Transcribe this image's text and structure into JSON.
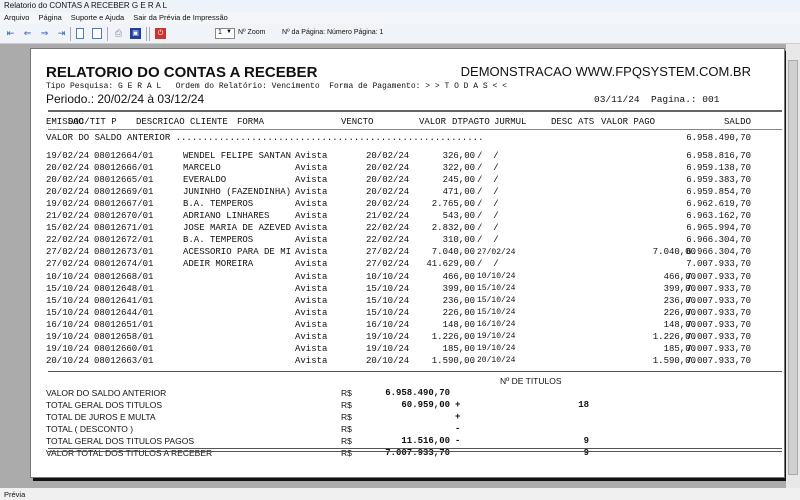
{
  "window": {
    "title": "Relatorio do CONTAS A RECEBER G E R A L"
  },
  "menu": [
    "Arquivo",
    "Página",
    "Suporte e Ajuda",
    "Sair da Prévia de Impressão"
  ],
  "toolbar": {
    "zoom_value": "1",
    "zoom_label": "Nº Zoom",
    "page_label": "Nº da Página: Número Página: 1"
  },
  "report": {
    "title": "RELATORIO DO CONTAS A RECEBER",
    "company": "DEMONSTRACAO WWW.FPQSYSTEM.COM.BR",
    "filters": "Tipo Pesquisa: G E R A L   Ordem do Relatório: Vencimento  Forma de Pagamento: > > T O D A S < <",
    "period": "Periodo.: 20/02/24 à 03/12/24",
    "date": "03/11/24",
    "page": "Pagina.: 001",
    "columns": {
      "emissao": "EMISSAO",
      "doc": "DOC/TIT P",
      "desc": "DESCRICAO CLIENTE",
      "forma": "FORMA",
      "vencto": "VENCTO",
      "valor": "VALOR",
      "dtpagto": "DTPAGTO",
      "jurmul": "JURMUL",
      "desc_ats": "DESC ATS",
      "valor_pago": "VALOR PAGO",
      "saldo": "SALDO"
    },
    "saldo_anterior_label": "VALOR DO SALDO ANTERIOR .........................................................",
    "saldo_anterior": "6.958.490,70",
    "rows": [
      [
        "19/02/24",
        "08012664/01",
        "WENDEL FELIPE SANTAN",
        "Avista",
        "20/02/24",
        "326,00",
        "/  /",
        "",
        "6.958.816,70"
      ],
      [
        "20/02/24",
        "08012666/01",
        "MARCELO",
        "Avista",
        "20/02/24",
        "322,00",
        "/  /",
        "",
        "6.959.138,70"
      ],
      [
        "20/02/24",
        "08012665/01",
        "EVERALDO",
        "Avista",
        "20/02/24",
        "245,00",
        "/  /",
        "",
        "6.959.383,70"
      ],
      [
        "20/02/24",
        "08012669/01",
        "JUNINHO (FAZENDINHA)",
        "Avista",
        "20/02/24",
        "471,00",
        "/  /",
        "",
        "6.959.854,70"
      ],
      [
        "19/02/24",
        "08012667/01",
        "B.A. TEMPEROS",
        "Avista",
        "20/02/24",
        "2.765,00",
        "/  /",
        "",
        "6.962.619,70"
      ],
      [
        "21/02/24",
        "08012670/01",
        "ADRIANO LINHARES",
        "Avista",
        "21/02/24",
        "543,00",
        "/  /",
        "",
        "6.963.162,70"
      ],
      [
        "15/02/24",
        "08012671/01",
        "JOSE MARIA DE AZEVED",
        "Avista",
        "22/02/24",
        "2.832,00",
        "/  /",
        "",
        "6.965.994,70"
      ],
      [
        "22/02/24",
        "08012672/01",
        "B.A. TEMPEROS",
        "Avista",
        "22/02/24",
        "310,00",
        "/  /",
        "",
        "6.966.304,70"
      ],
      [
        "27/02/24",
        "08012673/01",
        "ACESSORIO PARA DE MI",
        "Avista",
        "27/02/24",
        "7.040,00",
        "27/02/24",
        "7.040,00",
        "6.966.304,70"
      ],
      [
        "27/02/24",
        "08012674/01",
        "ADEIR MOREIRA",
        "Avista",
        "27/02/24",
        "41.629,00",
        "/  /",
        "",
        "7.007.933,70"
      ],
      [
        "10/10/24",
        "08012668/01",
        "",
        "Avista",
        "10/10/24",
        "466,00",
        "10/10/24",
        "466,00",
        "7.007.933,70"
      ],
      [
        "15/10/24",
        "08012648/01",
        "",
        "Avista",
        "15/10/24",
        "399,00",
        "15/10/24",
        "399,00",
        "7.007.933,70"
      ],
      [
        "15/10/24",
        "08012641/01",
        "",
        "Avista",
        "15/10/24",
        "236,00",
        "15/10/24",
        "236,00",
        "7.007.933,70"
      ],
      [
        "15/10/24",
        "08012644/01",
        "",
        "Avista",
        "15/10/24",
        "226,00",
        "15/10/24",
        "226,00",
        "7.007.933,70"
      ],
      [
        "16/10/24",
        "08012651/01",
        "",
        "Avista",
        "16/10/24",
        "148,00",
        "16/10/24",
        "148,00",
        "7.007.933,70"
      ],
      [
        "19/10/24",
        "08012658/01",
        "",
        "Avista",
        "19/10/24",
        "1.226,00",
        "19/10/24",
        "1.226,00",
        "7.007.933,70"
      ],
      [
        "19/10/24",
        "08012660/01",
        "",
        "Avista",
        "19/10/24",
        "185,00",
        "19/10/24",
        "185,00",
        "7.007.933,70"
      ],
      [
        "20/10/24",
        "08012663/01",
        "",
        "Avista",
        "20/10/24",
        "1.590,00",
        "20/10/24",
        "1.590,00",
        "7.007.933,70"
      ]
    ],
    "summary": {
      "count_header": "Nº DE TITULOS",
      "lines": [
        {
          "label": "VALOR DO SALDO ANTERIOR",
          "cur": "R$",
          "value": "6.958.490,70",
          "sign": "",
          "count": ""
        },
        {
          "label": "TOTAL GERAL DOS TITULOS",
          "cur": "R$",
          "value": "60.959,00",
          "sign": "+",
          "count": "18"
        },
        {
          "label": "TOTAL DE JUROS E MULTA",
          "cur": "R$",
          "value": "",
          "sign": "+",
          "count": ""
        },
        {
          "label": "TOTAL ( DESCONTO )",
          "cur": "R$",
          "value": "",
          "sign": "-",
          "count": ""
        },
        {
          "label": "TOTAL GERAL DOS TITULOS PAGOS",
          "cur": "R$",
          "value": "11.516,00",
          "sign": "-",
          "count": "9"
        },
        {
          "label": "VALOR TOTAL DOS TITULOS A RECEBER",
          "cur": "R$",
          "value": "7.007.933,70",
          "sign": "",
          "count": "9"
        }
      ]
    }
  },
  "status": "Prévia"
}
